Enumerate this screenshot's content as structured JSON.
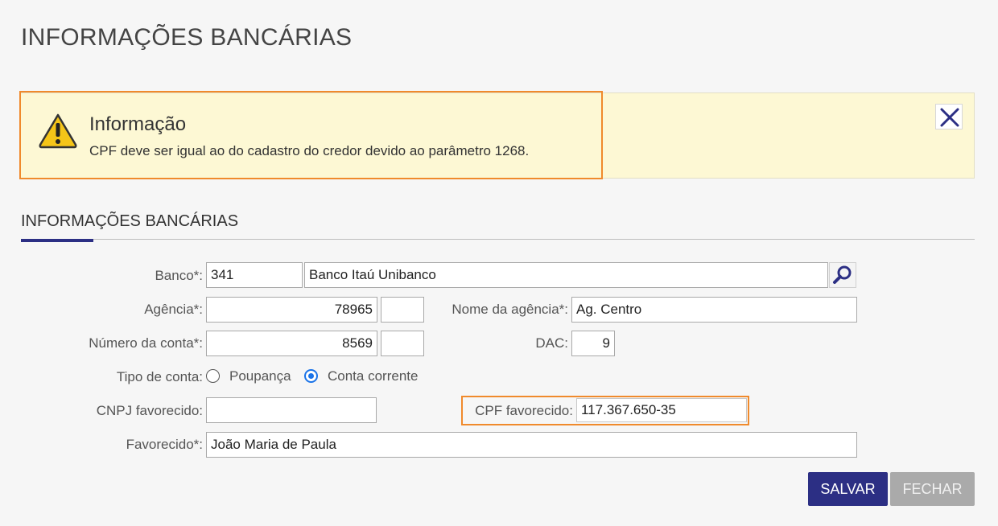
{
  "page": {
    "title": "INFORMAÇÕES BANCÁRIAS"
  },
  "alert": {
    "icon": "warning-icon",
    "title": "Informação",
    "message": "CPF deve ser igual ao do cadastro do credor devido ao parâmetro 1268.",
    "close_icon": "close-icon"
  },
  "section": {
    "title": "INFORMAÇÕES BANCÁRIAS"
  },
  "form": {
    "banco": {
      "label": "Banco*:",
      "code": "341",
      "name": "Banco Itaú Unibanco",
      "lookup_icon": "search-icon"
    },
    "agencia": {
      "label": "Agência*:",
      "value": "78965",
      "digit": ""
    },
    "nome_agencia": {
      "label": "Nome da agência*:",
      "value": "Ag. Centro"
    },
    "numero_conta": {
      "label": "Número da conta*:",
      "value": "8569",
      "digit": ""
    },
    "dac": {
      "label": "DAC:",
      "value": "9"
    },
    "tipo_conta": {
      "label": "Tipo de conta:",
      "options": [
        "Poupança",
        "Conta corrente"
      ],
      "selected": "Conta corrente"
    },
    "cnpj_favorecido": {
      "label": "CNPJ favorecido:",
      "value": ""
    },
    "cpf_favorecido": {
      "label": "CPF favorecido:",
      "value": "117.367.650-35"
    },
    "favorecido": {
      "label": "Favorecido*:",
      "value": "João Maria de Paula"
    }
  },
  "buttons": {
    "save": "SALVAR",
    "close": "FECHAR"
  },
  "colors": {
    "primary": "#2c2f84",
    "highlight": "#f08a2c",
    "alert_bg": "#fdf8d4",
    "disabled": "#aaaaaa"
  }
}
